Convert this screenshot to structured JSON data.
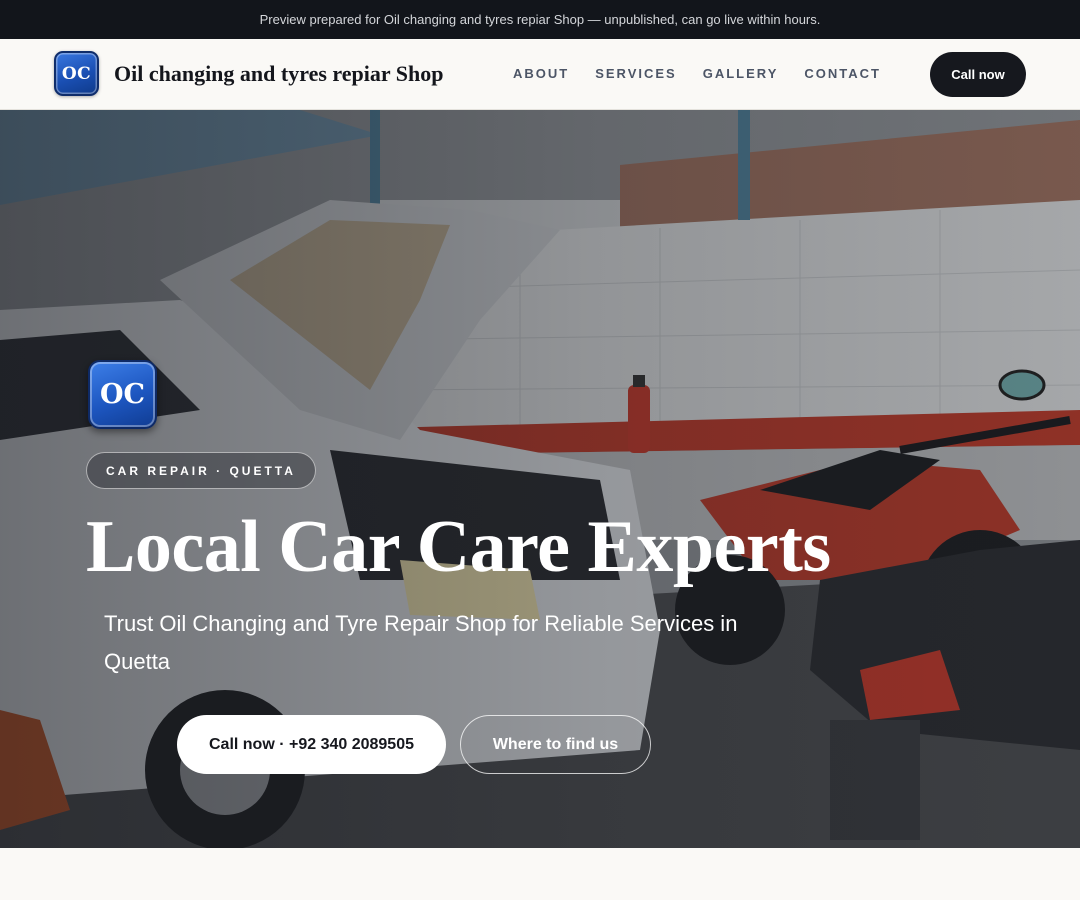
{
  "preview_banner": "Preview prepared for Oil changing and tyres repiar Shop — unpublished, can go live within hours.",
  "header": {
    "logo_text": "OC",
    "brand_name": "Oil changing and tyres repiar Shop",
    "nav": [
      "ABOUT",
      "SERVICES",
      "GALLERY",
      "CONTACT"
    ],
    "cta_label": "Call now"
  },
  "hero": {
    "logo_text": "OC",
    "tag": "CAR REPAIR · QUETTA",
    "title": "Local Car Care Experts",
    "subtitle": "Trust Oil Changing and Tyre Repair Shop for Reliable Services in Quetta",
    "primary_button": "Call now · +92 340 2089505",
    "secondary_button": "Where to find us",
    "background_image": "garage-photo: white car with open hood and red motorcycles"
  },
  "colors": {
    "top_bar": "#12151b",
    "header_bg": "#faf9f6",
    "cta_dark": "#16181e",
    "logo_blue": "#1d56c0"
  }
}
